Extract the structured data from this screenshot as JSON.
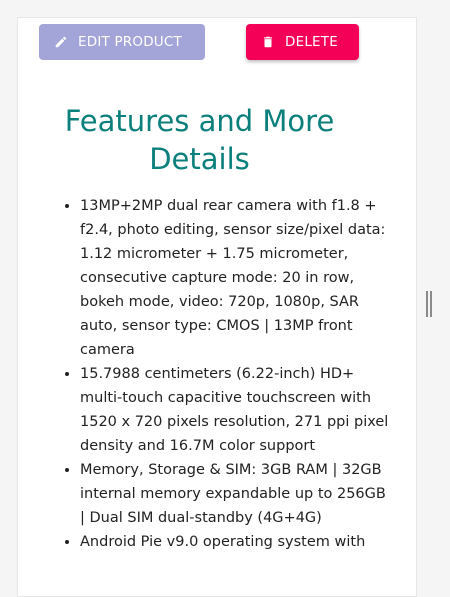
{
  "actions": {
    "edit_label": "EDIT PRODUCT",
    "delete_label": "DELETE",
    "edit_icon": "pencil-icon",
    "delete_icon": "trash-icon"
  },
  "colors": {
    "edit_button_bg": "#a3a4d7",
    "delete_button_bg": "#f50057",
    "title_color": "#0b7f7c"
  },
  "section": {
    "title": "Features and More Details"
  },
  "features": [
    "13MP+2MP dual rear camera with f1.8 + f2.4, photo editing, sensor size/pixel data: 1.12 micrometer + 1.75 micrometer, consecutive capture mode: 20 in row, bokeh mode, video: 720p, 1080p, SAR auto, sensor type: CMOS | 13MP front camera",
    "15.7988 centimeters (6.22-inch) HD+ multi-touch capacitive touchscreen with 1520 x 720 pixels resolution, 271 ppi pixel density and 16.7M color support",
    "Memory, Storage & SIM: 3GB RAM | 32GB internal memory expandable up to 256GB | Dual SIM dual-standby (4G+4G)",
    "Android Pie v9.0 operating system with"
  ]
}
